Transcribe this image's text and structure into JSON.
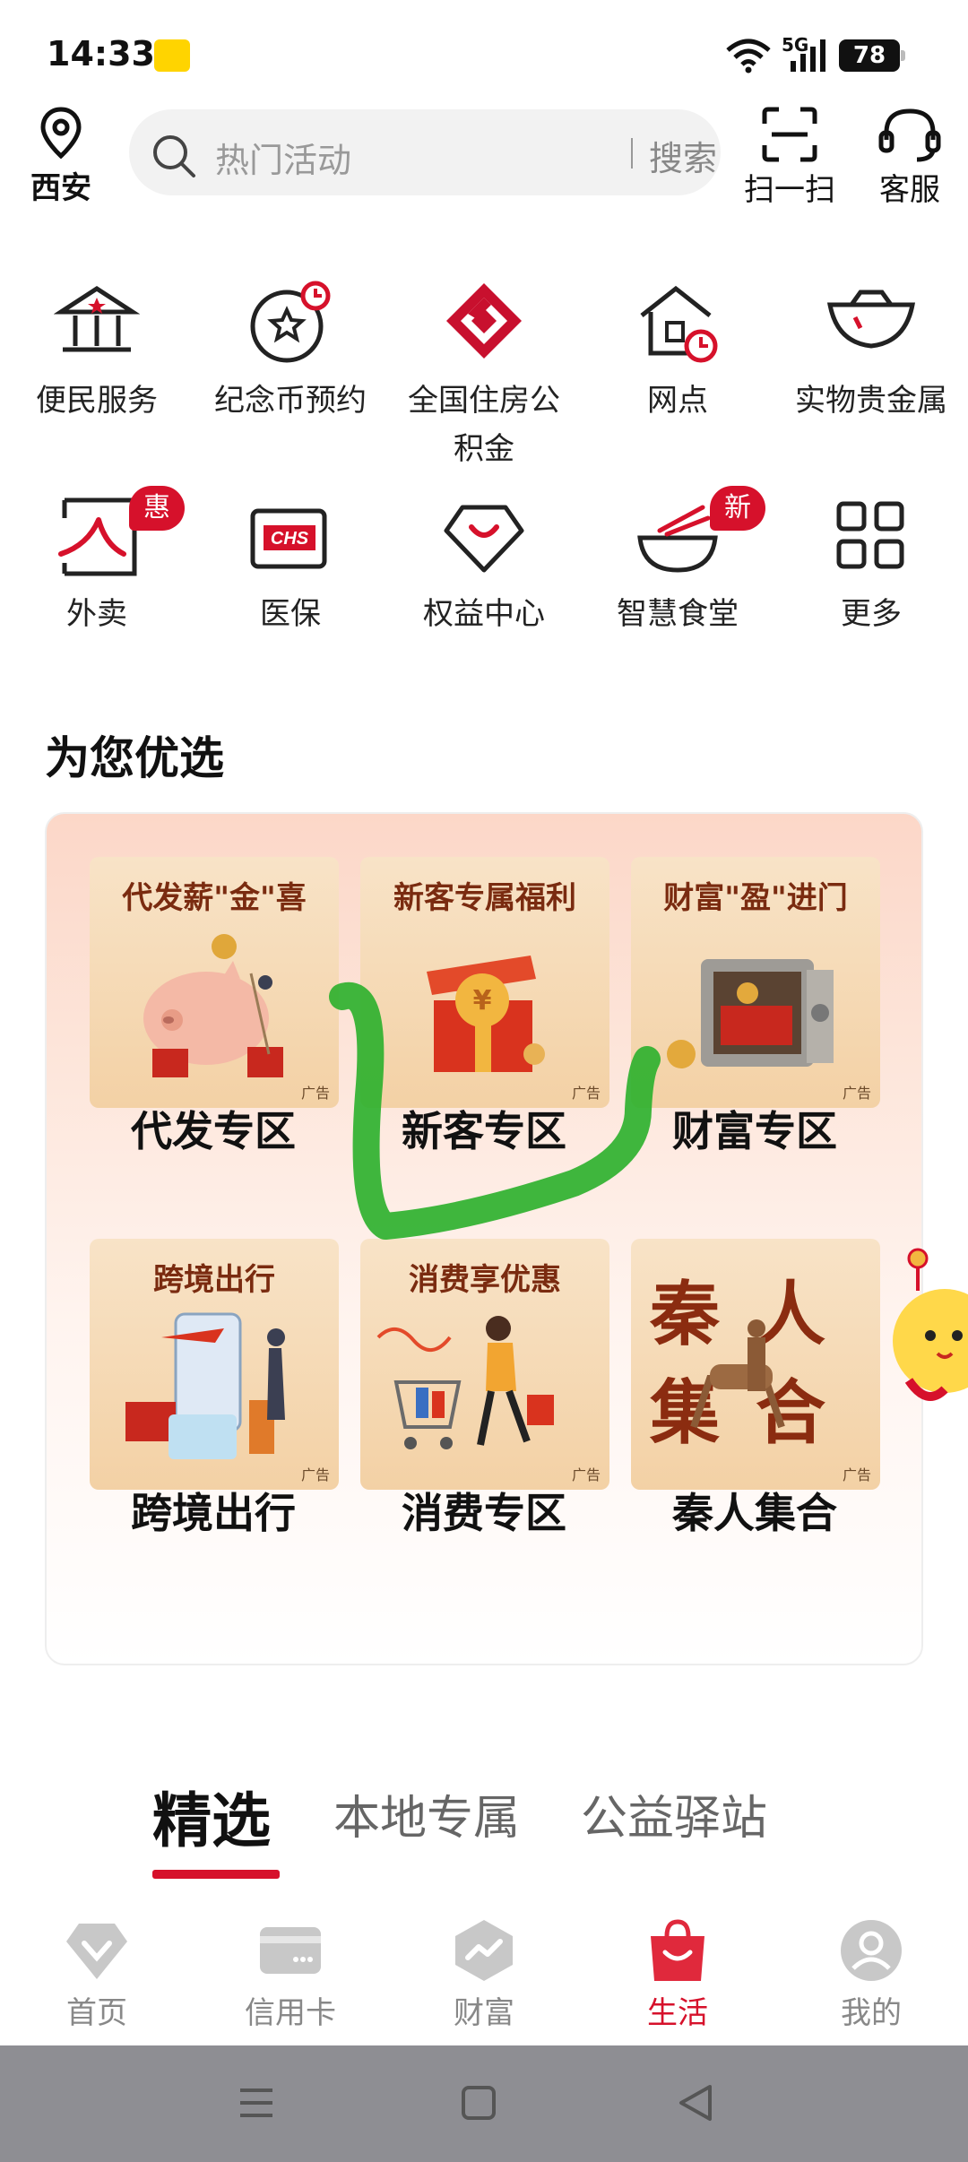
{
  "status_bar": {
    "time": "14:33",
    "network": "5G",
    "battery": "78"
  },
  "header": {
    "location": "西安",
    "search_placeholder": "热门活动",
    "search_button": "搜索",
    "scan_label": "扫一扫",
    "service_label": "客服"
  },
  "services": [
    {
      "label": "便民服务",
      "icon": "bank-icon"
    },
    {
      "label": "纪念币预约",
      "icon": "coin-star-icon"
    },
    {
      "label": "全国住房公积金",
      "icon": "housing-fund-logo-icon"
    },
    {
      "label": "网点",
      "icon": "branch-clock-icon"
    },
    {
      "label": "实物贵金属",
      "icon": "gold-ingot-icon"
    },
    {
      "label": "外卖",
      "icon": "takeout-icon",
      "badge": "惠"
    },
    {
      "label": "医保",
      "icon": "chs-card-icon"
    },
    {
      "label": "权益中心",
      "icon": "diamond-icon"
    },
    {
      "label": "智慧食堂",
      "icon": "bowl-icon",
      "badge": "新"
    },
    {
      "label": "更多",
      "icon": "grid-more-icon"
    }
  ],
  "section_title": "为您优选",
  "promos": [
    {
      "tile_title": "代发薪\"金\"喜",
      "ad": "广告",
      "zone": "代发专区"
    },
    {
      "tile_title": "新客专属福利",
      "ad": "广告",
      "zone": "新客专区"
    },
    {
      "tile_title": "财富\"盈\"进门",
      "ad": "广告",
      "zone": "财富专区"
    },
    {
      "tile_title": "跨境出行",
      "ad": "广告",
      "zone": "跨境出行"
    },
    {
      "tile_title": "消费享优惠",
      "ad": "广告",
      "zone": "消费专区"
    },
    {
      "tile_title": "秦人集合",
      "ad": "广告",
      "zone": "秦人集合"
    }
  ],
  "feed_tabs": [
    {
      "label": "精选",
      "active": true
    },
    {
      "label": "本地专属",
      "active": false
    },
    {
      "label": "公益驿站",
      "active": false
    }
  ],
  "bottom_nav": [
    {
      "label": "首页",
      "icon": "home-diamond-icon",
      "active": false
    },
    {
      "label": "信用卡",
      "icon": "credit-card-icon",
      "active": false
    },
    {
      "label": "财富",
      "icon": "wealth-chart-icon",
      "active": false
    },
    {
      "label": "生活",
      "icon": "shopping-bag-icon",
      "active": true
    },
    {
      "label": "我的",
      "icon": "profile-icon",
      "active": false
    }
  ],
  "colors": {
    "brand": "#d6112b",
    "scribble": "#2fb12f"
  }
}
